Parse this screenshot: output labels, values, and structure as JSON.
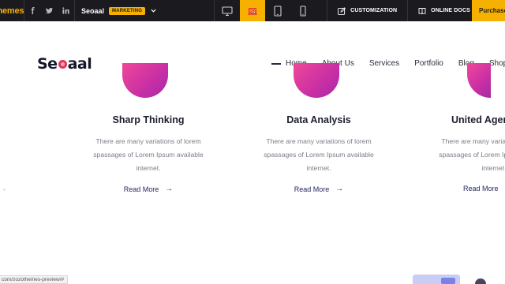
{
  "topbar": {
    "brand": "themes",
    "social": [
      "facebook-icon",
      "twitter-icon",
      "linkedin-icon"
    ],
    "theme_name": "Seoaal",
    "theme_tag": "MARKETING",
    "devices": [
      "desktop-icon",
      "laptop-icon",
      "tablet-icon",
      "mobile-icon"
    ],
    "active_device": "laptop-icon",
    "customization": "CUSTOMIZATION",
    "docs": "ONLINE DOCS",
    "purchase": "Purchase",
    "accent": "#f5b000"
  },
  "site": {
    "logo_pre": "Se",
    "logo_post": "aal",
    "nav": [
      "Home",
      "About Us",
      "Services",
      "Portfolio",
      "Blog",
      "Shop"
    ]
  },
  "features": [
    {
      "title": "Sharp Thinking",
      "text": "There are many variations of lorem spassages of Lorem Ipsum available internet.",
      "link": "Read More"
    },
    {
      "title": "Data Analysis",
      "text": "There are many variations of lorem spassages of Lorem Ipsum available internet.",
      "link": "Read More"
    },
    {
      "title": "United Agency",
      "text": "There are many variations of lorem spassages of Lorem Ipsum available internet.",
      "link": "Read More"
    }
  ],
  "status_url": "com/zozothemes-preview/#",
  "colors": {
    "gradient_start": "#f0489a",
    "gradient_end": "#a52aa8"
  }
}
